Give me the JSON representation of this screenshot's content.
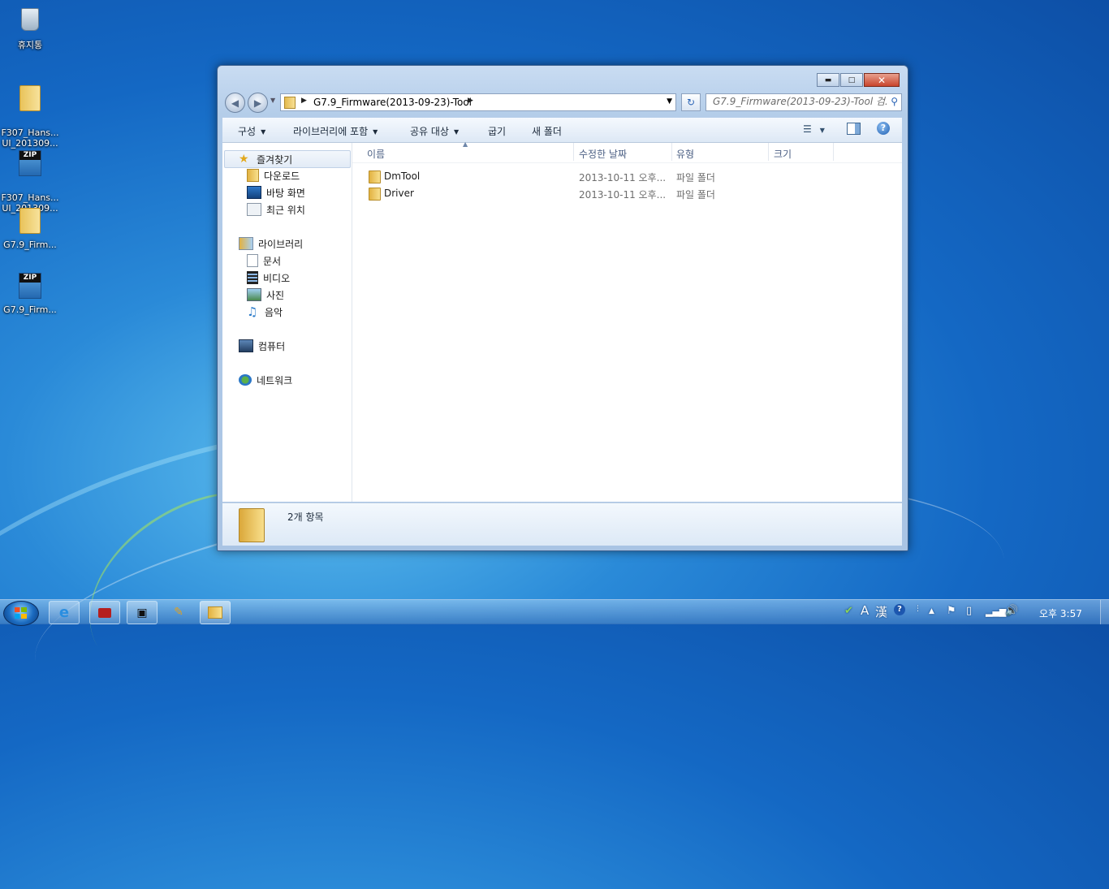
{
  "desktop": {
    "icons": [
      {
        "label": "휴지통",
        "type": "recycle-bin"
      },
      {
        "label": "F307_Hans...\nUI_201309...",
        "type": "folder"
      },
      {
        "label": "F307_Hans...\nUI_201309...",
        "type": "zip"
      },
      {
        "label": "G7.9_Firm...",
        "type": "folder"
      },
      {
        "label": "G7.9_Firm...",
        "type": "zip"
      }
    ],
    "zip_badge": "ZIP"
  },
  "window": {
    "address": {
      "path": "G7.9_Firmware(2013-09-23)-Tool"
    },
    "search": {
      "placeholder": "G7.9_Firmware(2013-09-23)-Tool 검..."
    },
    "toolbar": {
      "organize": "구성",
      "include_in_library": "라이브러리에 포함",
      "share_with": "공유 대상",
      "burn": "굽기",
      "new_folder": "새 폴더"
    },
    "navpane": {
      "favorites": "즐겨찾기",
      "downloads": "다운로드",
      "desktop": "바탕 화면",
      "recent": "최근 위치",
      "libraries": "라이브러리",
      "documents": "문서",
      "videos": "비디오",
      "pictures": "사진",
      "music": "음악",
      "computer": "컴퓨터",
      "network": "네트워크"
    },
    "columns": {
      "name": "이름",
      "date_modified": "수정한 날짜",
      "type": "유형",
      "size": "크기"
    },
    "files": [
      {
        "name": "DmTool",
        "date": "2013-10-11 오후...",
        "type": "파일 폴더"
      },
      {
        "name": "Driver",
        "date": "2013-10-11 오후...",
        "type": "파일 폴더"
      }
    ],
    "details": {
      "count": "2개 항목"
    }
  },
  "taskbar": {
    "tray": {
      "ime_a": "A",
      "ime_han": "漢",
      "clock": "오후 3:57"
    }
  },
  "colors": {
    "desktop_blue": "#1468c4",
    "window_frame": "#b4cde9",
    "close_red": "#c9452d"
  }
}
